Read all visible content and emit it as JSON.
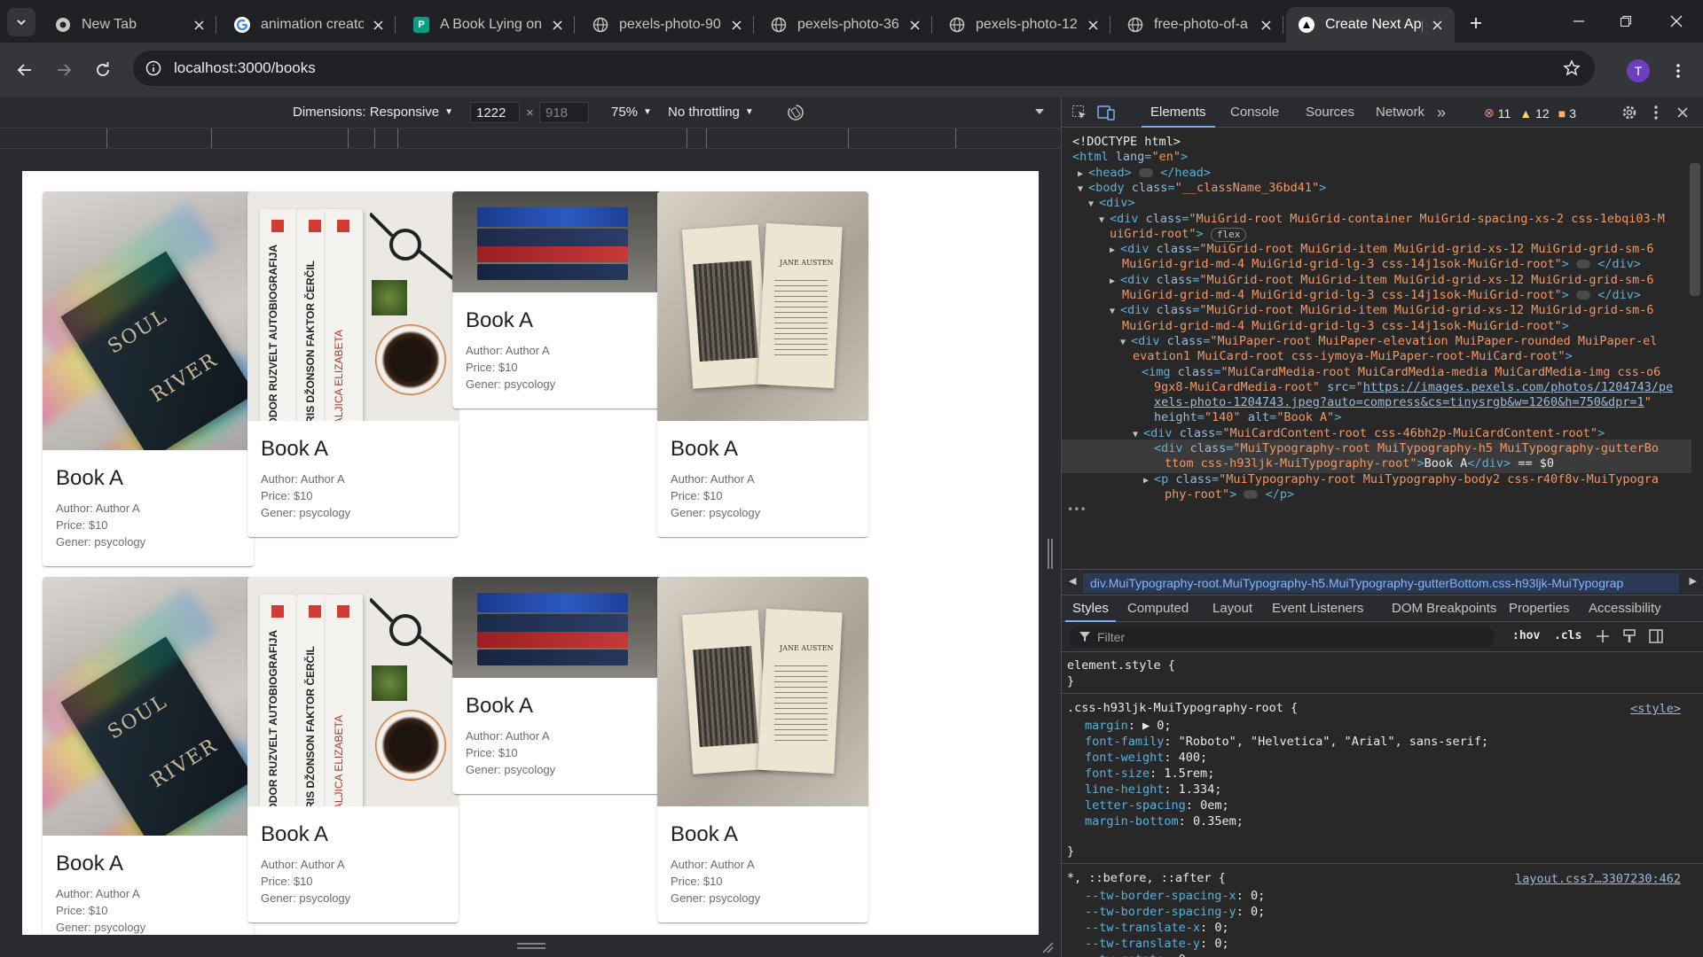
{
  "browser": {
    "tabs": [
      {
        "title": "New Tab",
        "favicon": "chrome"
      },
      {
        "title": "animation creato",
        "favicon": "google"
      },
      {
        "title": "A Book Lying on",
        "favicon": "pexels-green"
      },
      {
        "title": "pexels-photo-90",
        "favicon": "globe"
      },
      {
        "title": "pexels-photo-36",
        "favicon": "globe"
      },
      {
        "title": "pexels-photo-12",
        "favicon": "globe"
      },
      {
        "title": "free-photo-of-a",
        "favicon": "globe"
      },
      {
        "title": "Create Next App",
        "favicon": "nextjs",
        "active": true
      }
    ],
    "url": "localhost:3000/books",
    "profile_initial": "T"
  },
  "device_toolbar": {
    "dimensions_label": "Dimensions: Responsive",
    "width": "1222",
    "height": "918",
    "zoom": "75%",
    "throttling": "No throttling"
  },
  "books": [
    {
      "title": "Book A",
      "author": "Author: Author A",
      "price": "Price: $10",
      "genre": "Gener: psycology",
      "image": "soul-river"
    },
    {
      "title": "Book A",
      "author": "Author: Author A",
      "price": "Price: $10",
      "genre": "Gener: psycology",
      "image": "book-spines"
    },
    {
      "title": "Book A",
      "author": "Author: Author A",
      "price": "Price: $10",
      "genre": "Gener: psycology",
      "image": "book-stack"
    },
    {
      "title": "Book A",
      "author": "Author: Author A",
      "price": "Price: $10",
      "genre": "Gener: psycology",
      "image": "open-book"
    },
    {
      "title": "Book A",
      "author": "Author: Author A",
      "price": "Price: $10",
      "genre": "Gener: psycology",
      "image": "soul-river"
    },
    {
      "title": "Book A",
      "author": "Author: Author A",
      "price": "Price: $10",
      "genre": "Gener: psycology",
      "image": "book-spines"
    },
    {
      "title": "Book A",
      "author": "Author: Author A",
      "price": "Price: $10",
      "genre": "Gener: psycology",
      "image": "book-stack"
    },
    {
      "title": "Book A",
      "author": "Author: Author A",
      "price": "Price: $10",
      "genre": "Gener: psycology",
      "image": "open-book"
    }
  ],
  "photo_text": {
    "soul": "SOUL",
    "river": "RIVER",
    "spine1": "TEODOR RUZVELT AUTOBIOGRAFIJA",
    "spine2": "BORIS DŽONSON FAKTOR ČERČIL",
    "spine3": "KRALJICA ELIZABETA",
    "open_book": "JANE AUSTEN"
  },
  "devtools": {
    "tabs": [
      "Elements",
      "Console",
      "Sources",
      "Network"
    ],
    "active_tab": "Elements",
    "errors": "11",
    "warnings": "12",
    "issues": "3",
    "dom_lines": [
      {
        "html": "<span class='plain'>&lt;!DOCTYPE html&gt;</span>"
      },
      {
        "html": "<span class='tag'>&lt;html </span><span class='attr'>lang</span><span class='tag'>=</span><span class='attrv'>\"en\"</span><span class='tag'>&gt;</span>"
      },
      {
        "html": "<span class='tri'>▶</span><span class='tag'>&lt;head&gt;</span> <span class='ell'></span> <span class='tag'>&lt;/head&gt;</span>"
      },
      {
        "html": "<span class='tri'>▼</span><span class='tag'>&lt;body </span><span class='attr'>class</span><span class='tag'>=</span><span class='attrv'>\"__className_36bd41\"</span><span class='tag'>&gt;</span>"
      },
      {
        "html": "<span class='tri'>▼</span><span class='tag'>&lt;div&gt;</span>"
      },
      {
        "html": "<span class='tri'>▼</span><span class='tag'>&lt;div </span><span class='attr'>class</span><span class='tag'>=</span><span class='attrv'>\"MuiGrid-root MuiGrid-container MuiGrid-spacing-xs-2 css-1ebqi03-M</span>"
      },
      {
        "html": "<span class='attrv'>uiGrid-root\"</span><span class='tag'>&gt;</span> <span class='badge'>flex</span>"
      },
      {
        "html": "<span class='tri'>▶</span><span class='tag'>&lt;div </span><span class='attr'>class</span><span class='tag'>=</span><span class='attrv'>\"MuiGrid-root MuiGrid-item MuiGrid-grid-xs-12 MuiGrid-grid-sm-6</span>"
      },
      {
        "html": "<span class='attrv'>MuiGrid-grid-md-4 MuiGrid-grid-lg-3 css-14j1sok-MuiGrid-root\"</span><span class='tag'>&gt;</span> <span class='ell'></span> <span class='tag'>&lt;/div&gt;</span>"
      },
      {
        "html": "<span class='tri'>▶</span><span class='tag'>&lt;div </span><span class='attr'>class</span><span class='tag'>=</span><span class='attrv'>\"MuiGrid-root MuiGrid-item MuiGrid-grid-xs-12 MuiGrid-grid-sm-6</span>"
      },
      {
        "html": "<span class='attrv'>MuiGrid-grid-md-4 MuiGrid-grid-lg-3 css-14j1sok-MuiGrid-root\"</span><span class='tag'>&gt;</span> <span class='ell'></span> <span class='tag'>&lt;/div&gt;</span>"
      },
      {
        "html": "<span class='tri'>▼</span><span class='tag'>&lt;div </span><span class='attr'>class</span><span class='tag'>=</span><span class='attrv'>\"MuiGrid-root MuiGrid-item MuiGrid-grid-xs-12 MuiGrid-grid-sm-6</span>"
      },
      {
        "html": "<span class='attrv'>MuiGrid-grid-md-4 MuiGrid-grid-lg-3 css-14j1sok-MuiGrid-root\"</span><span class='tag'>&gt;</span>"
      },
      {
        "html": "<span class='tri'>▼</span><span class='tag'>&lt;div </span><span class='attr'>class</span><span class='tag'>=</span><span class='attrv'>\"MuiPaper-root MuiPaper-elevation MuiPaper-rounded MuiPaper-el</span>"
      },
      {
        "html": "<span class='attrv'>evation1 MuiCard-root css-iymoya-MuiPaper-root-MuiCard-root\"</span><span class='tag'>&gt;</span>"
      },
      {
        "html": "<span class='tag'>&lt;img </span><span class='attr'>class</span><span class='tag'>=</span><span class='attrv'>\"MuiCardMedia-root MuiCardMedia-media MuiCardMedia-img css-o6</span>"
      },
      {
        "html": "<span class='attrv'>9gx8-MuiCardMedia-root\"</span> <span class='attr'>src</span><span class='tag'>=</span><span class='attrv'>\"</span><span class='link'>https://images.pexels.com/photos/1204743/pe</span>"
      },
      {
        "html": "<span class='link'>xels-photo-1204743.jpeg?auto=compress&amp;cs=tinysrgb&amp;w=1260&amp;h=750&amp;dpr=1</span><span class='attrv'>\"</span>"
      },
      {
        "html": "<span class='attr'>height</span><span class='tag'>=</span><span class='attrv'>\"140\"</span> <span class='attr'>alt</span><span class='tag'>=</span><span class='attrv'>\"Book A\"</span><span class='tag'>&gt;</span>"
      },
      {
        "html": "<span class='tri'>▼</span><span class='tag'>&lt;div </span><span class='attr'>class</span><span class='tag'>=</span><span class='attrv'>\"MuiCardContent-root css-46bh2p-MuiCardContent-root\"</span><span class='tag'>&gt;</span>"
      },
      {
        "html": "<span class='tag'>&lt;div </span><span class='attr'>class</span><span class='tag'>=</span><span class='attrv'>\"MuiTypography-root MuiTypography-h5 MuiTypography-gutterBo</span>"
      },
      {
        "html": "<span class='attrv'>ttom css-h93ljk-MuiTypography-root\"</span><span class='tag'>&gt;</span><span class='plain'>Book A</span><span class='tag'>&lt;/div&gt;</span> <span class='plain'>== $0</span>"
      },
      {
        "html": "<span class='tri'>▶</span><span class='tag'>&lt;p </span><span class='attr'>class</span><span class='tag'>=</span><span class='attrv'>\"MuiTypography-root MuiTypography-body2 css-r40f8v-MuiTypogra</span>"
      },
      {
        "html": "<span class='attrv'>phy-root\"</span><span class='tag'>&gt;</span> <span class='ell'></span> <span class='tag'>&lt;/p&gt;</span>"
      }
    ],
    "breadcrumb": "div.MuiTypography-root.MuiTypography-h5.MuiTypography-gutterBottom.css-h93ljk-MuiTypograp",
    "style_tabs": [
      "Styles",
      "Computed",
      "Layout",
      "Event Listeners",
      "DOM Breakpoints",
      "Properties",
      "Accessibility"
    ],
    "filter_placeholder": "Filter",
    "hov": ":hov",
    "cls": ".cls",
    "rules": {
      "element_style": "element.style {",
      "close": "}",
      "selector1": ".css-h93ljk-MuiTypography-root {",
      "source1": "<style>",
      "props1": [
        {
          "p": "margin",
          "v": "▶ 0;"
        },
        {
          "p": "font-family",
          "v": "\"Roboto\", \"Helvetica\", \"Arial\", sans-serif;"
        },
        {
          "p": "font-weight",
          "v": "400;"
        },
        {
          "p": "font-size",
          "v": "1.5rem;"
        },
        {
          "p": "line-height",
          "v": "1.334;"
        },
        {
          "p": "letter-spacing",
          "v": "0em;"
        },
        {
          "p": "margin-bottom",
          "v": "0.35em;"
        }
      ],
      "selector2": "*, ::before, ::after {",
      "source2": "layout.css?…3307230:462",
      "props2": [
        {
          "p": "--tw-border-spacing-x",
          "v": "0;"
        },
        {
          "p": "--tw-border-spacing-y",
          "v": "0;"
        },
        {
          "p": "--tw-translate-x",
          "v": "0;"
        },
        {
          "p": "--tw-translate-y",
          "v": "0;"
        },
        {
          "p": "--tw-rotate",
          "v": "0;"
        }
      ]
    }
  }
}
